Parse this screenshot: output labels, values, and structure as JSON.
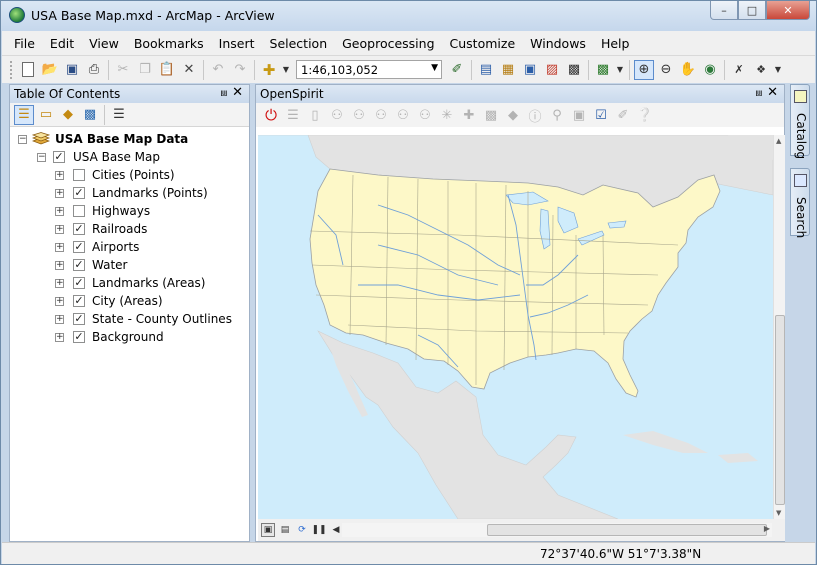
{
  "window": {
    "title": "USA Base Map.mxd - ArcMap - ArcView",
    "minimize": "–",
    "maximize": "□",
    "close": "✕"
  },
  "menu": [
    "File",
    "Edit",
    "View",
    "Bookmarks",
    "Insert",
    "Selection",
    "Geoprocessing",
    "Customize",
    "Windows",
    "Help"
  ],
  "toolbar": {
    "scale_value": "1:46,103,052"
  },
  "toc": {
    "title": "Table Of Contents",
    "pin": "⩏",
    "close": "✕",
    "dataframe": "USA Base Map Data",
    "group": "USA Base Map",
    "layers": [
      {
        "label": "Cities (Points)",
        "checked": false
      },
      {
        "label": "Landmarks (Points)",
        "checked": true
      },
      {
        "label": "Highways",
        "checked": false
      },
      {
        "label": "Railroads",
        "checked": true
      },
      {
        "label": "Airports",
        "checked": true
      },
      {
        "label": "Water",
        "checked": true
      },
      {
        "label": "Landmarks (Areas)",
        "checked": true
      },
      {
        "label": "City (Areas)",
        "checked": true
      },
      {
        "label": "State - County Outlines",
        "checked": true
      },
      {
        "label": "Background",
        "checked": true
      }
    ]
  },
  "openspirit": {
    "title": "OpenSpirit",
    "pin": "⩏",
    "close": "✕"
  },
  "side_tabs": {
    "catalog": "Catalog",
    "search": "Search"
  },
  "status": {
    "coordinates": "72°37'40.6\"W  51°7'3.38\"N"
  },
  "colors": {
    "land": "#fdf8c8",
    "foreign_land": "#e3e3e3",
    "ocean": "#cfecfb",
    "rivers": "#6fa0d8",
    "borders": "#a8a68c"
  }
}
